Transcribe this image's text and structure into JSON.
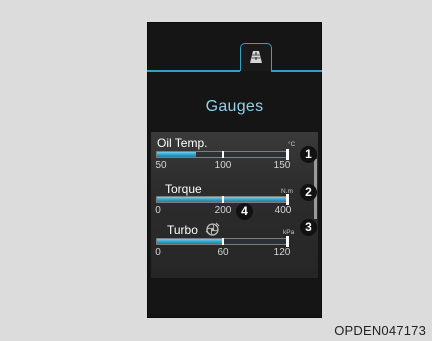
{
  "screen": {
    "tab_icon": "road-lanes-icon",
    "title": "Gauges"
  },
  "gauges": [
    {
      "label": "Oil Temp.",
      "unit": "°C",
      "ticks": [
        "50",
        "100",
        "150"
      ],
      "fill_fraction": 0.3,
      "callout": "1"
    },
    {
      "label": "Torque",
      "unit": "N.m",
      "ticks": [
        "0",
        "200",
        "400"
      ],
      "fill_fraction": 1.0,
      "callout": "2"
    },
    {
      "label": "Turbo",
      "unit": "kPa",
      "ticks": [
        "0",
        "60",
        "120"
      ],
      "fill_fraction": 0.5,
      "callout": "3",
      "icon": "turbo-icon"
    }
  ],
  "callouts": {
    "turbo_icon": "4"
  },
  "figure_code": "OPDEN047173",
  "colors": {
    "accent": "#2fa3c4",
    "title": "#8fd2ec",
    "screen_bg": "#151515",
    "panel_bg": "#2c2c2c"
  }
}
